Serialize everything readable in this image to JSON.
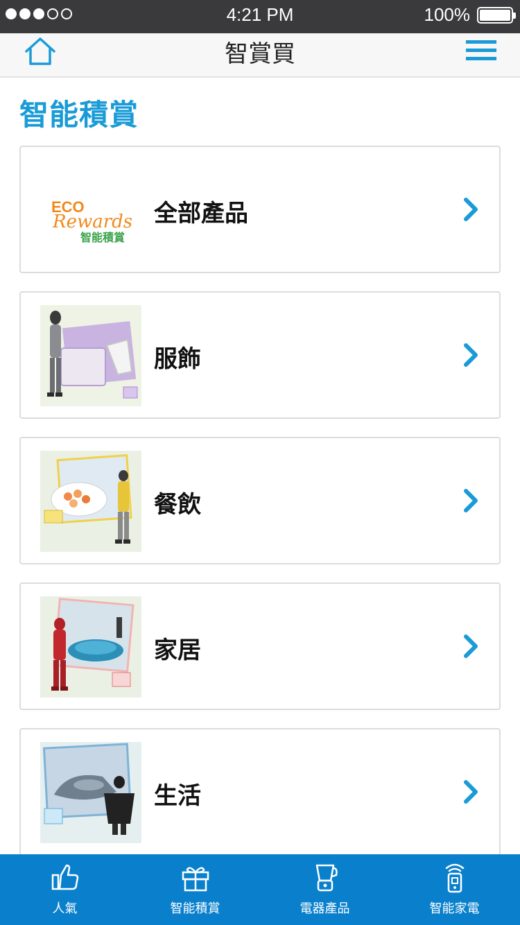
{
  "status_bar": {
    "time": "4:21 PM",
    "battery": "100%"
  },
  "nav": {
    "title": "智賞買"
  },
  "section": {
    "title": "智能積賞"
  },
  "logo": {
    "line1": "ECO",
    "line2": "Rewards",
    "line3": "智能積賞"
  },
  "categories": [
    {
      "label": "全部產品",
      "thumb": "eco-rewards-logo"
    },
    {
      "label": "服飾",
      "thumb": "fashion-photo"
    },
    {
      "label": "餐飲",
      "thumb": "dining-photo"
    },
    {
      "label": "家居",
      "thumb": "home-photo"
    },
    {
      "label": "生活",
      "thumb": "living-photo"
    }
  ],
  "tabs": [
    {
      "label": "人氣",
      "icon": "thumbs-up-icon"
    },
    {
      "label": "智能積賞",
      "icon": "gift-icon"
    },
    {
      "label": "電器產品",
      "icon": "blender-icon"
    },
    {
      "label": "智能家電",
      "icon": "smart-remote-icon"
    }
  ],
  "colors": {
    "accent": "#1a9bd7",
    "tabbar": "#0a80cc",
    "statusbar": "#3a3a3c"
  }
}
